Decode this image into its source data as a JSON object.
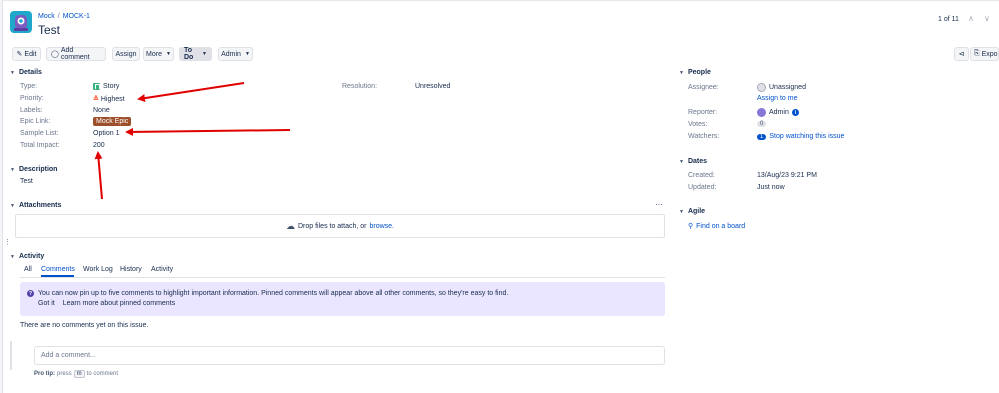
{
  "breadcrumb": {
    "project": "Mock",
    "separator": "/",
    "issue_key": "MOCK-1"
  },
  "issue": {
    "title": "Test"
  },
  "pager": {
    "position": "1 of 11"
  },
  "toolbar": {
    "edit": "Edit",
    "add_comment": "Add comment",
    "assign": "Assign",
    "more": "More",
    "status": "To Do",
    "admin": "Admin",
    "export": "Expo"
  },
  "details": {
    "heading": "Details",
    "fields": {
      "type": {
        "label": "Type:",
        "value": "Story"
      },
      "priority": {
        "label": "Priority:",
        "value": "Highest"
      },
      "labels": {
        "label": "Labels:",
        "value": "None"
      },
      "epic_link": {
        "label": "Epic Link:",
        "value": "Mock Epic"
      },
      "sample_list": {
        "label": "Sample List:",
        "value": "Option 1"
      },
      "total_impact": {
        "label": "Total Impact:",
        "value": "200"
      },
      "resolution": {
        "label": "Resolution:",
        "value": "Unresolved"
      }
    }
  },
  "description": {
    "heading": "Description",
    "text": "Test"
  },
  "attachments": {
    "heading": "Attachments",
    "drop_text": "Drop files to attach, or",
    "browse": "browse."
  },
  "activity": {
    "heading": "Activity",
    "tabs": [
      "All",
      "Comments",
      "Work Log",
      "History",
      "Activity"
    ],
    "active_tab": "Comments",
    "info_message": "You can now pin up to five comments to highlight important information. Pinned comments will appear above all other comments, so they're easy to find.",
    "got_it": "Got it",
    "learn_more": "Learn more about pinned comments",
    "empty_text": "There are no comments yet on this issue.",
    "comment_placeholder": "Add a comment...",
    "pro_tip_label": "Pro tip:",
    "pro_tip_press": "press",
    "pro_tip_key": "m",
    "pro_tip_suffix": "to comment"
  },
  "people": {
    "heading": "People",
    "assignee_label": "Assignee:",
    "assignee_value": "Unassigned",
    "assign_to_me": "Assign to me",
    "reporter_label": "Reporter:",
    "reporter_value": "Admin",
    "votes_label": "Votes:",
    "votes_count": "0",
    "watchers_label": "Watchers:",
    "watchers_count": "1",
    "watchers_link": "Stop watching this issue"
  },
  "dates": {
    "heading": "Dates",
    "created_label": "Created:",
    "created_value": "13/Aug/23 9:21 PM",
    "updated_label": "Updated:",
    "updated_value": "Just now"
  },
  "agile": {
    "heading": "Agile",
    "link": "Find on a board"
  },
  "colors": {
    "link": "#0052cc",
    "annotation_arrow": "#e00000",
    "epic": "#9c4f2a",
    "story": "#36b37e",
    "info_bg": "#eae6ff"
  }
}
